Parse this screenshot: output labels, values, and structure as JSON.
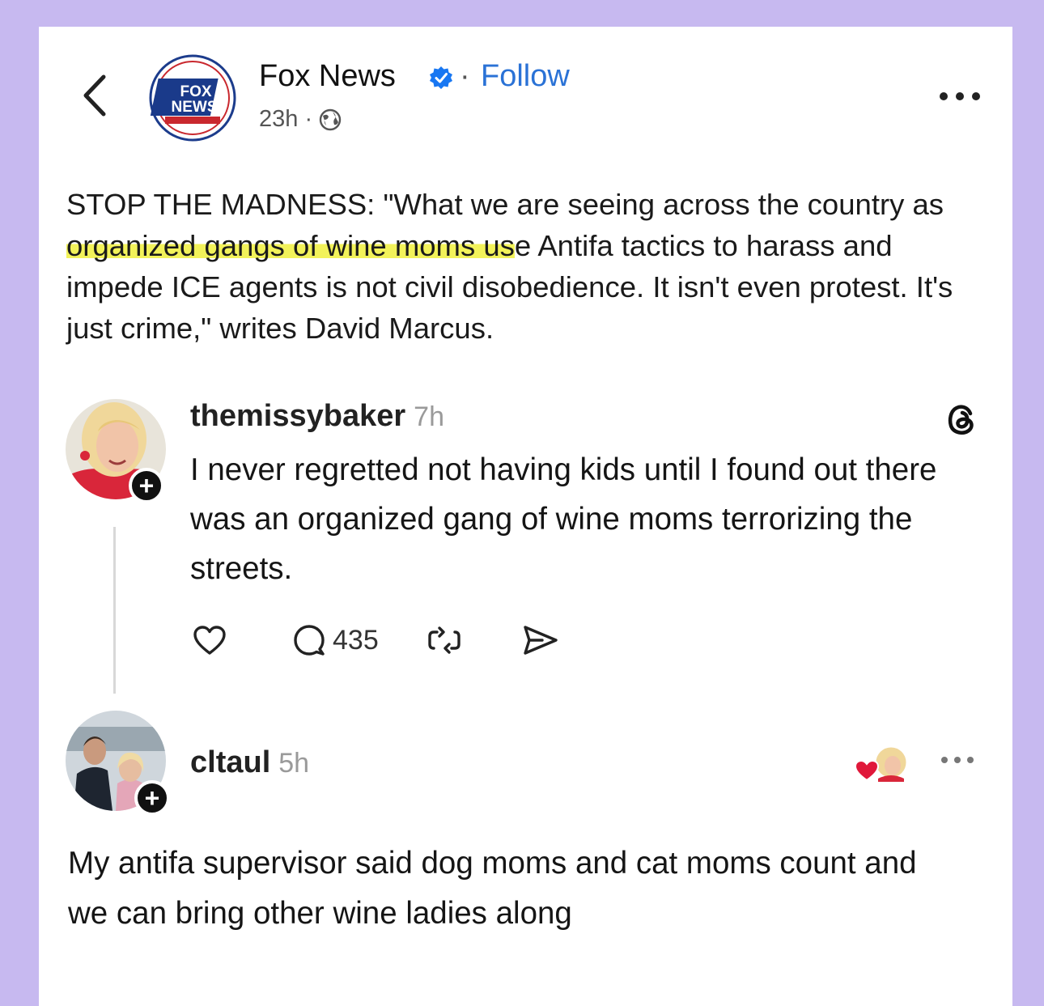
{
  "post": {
    "author": "Fox News",
    "follow_separator": "·",
    "follow_label": "Follow",
    "timestamp": "23h ·",
    "logo_text": "FOX NEWS channel",
    "caption_part1": "STOP THE MADNESS: \"What we are seeing across the country as ",
    "caption_highlight": "organized gangs of wine moms us",
    "caption_part2": "e Antifa tactics to harass and impede ICE agents is not civil disobedience. It isn't even protest. It's just crime,\" writes David Marcus."
  },
  "replies": [
    {
      "username": "themissybaker",
      "time": "7h",
      "text": "I never regretted not having kids until I found out there was an organized gang of wine moms terrorizing the streets.",
      "reply_count": "435"
    },
    {
      "username": "cltaul",
      "time": "5h",
      "text": "My antifa supervisor said dog moms and cat moms count and we can bring other wine ladies along"
    }
  ],
  "icons": [
    "back-chevron-icon",
    "verified-badge-icon",
    "globe-icon",
    "more-options-icon",
    "threads-logo-icon",
    "heart-icon",
    "comment-icon",
    "repost-icon",
    "share-icon",
    "follow-plus-icon"
  ],
  "colors": {
    "background": "#c7b9f0",
    "card": "#ffffff",
    "link": "#2a72d6",
    "highlight": "#f2f25a",
    "verified": "#1877f2"
  }
}
